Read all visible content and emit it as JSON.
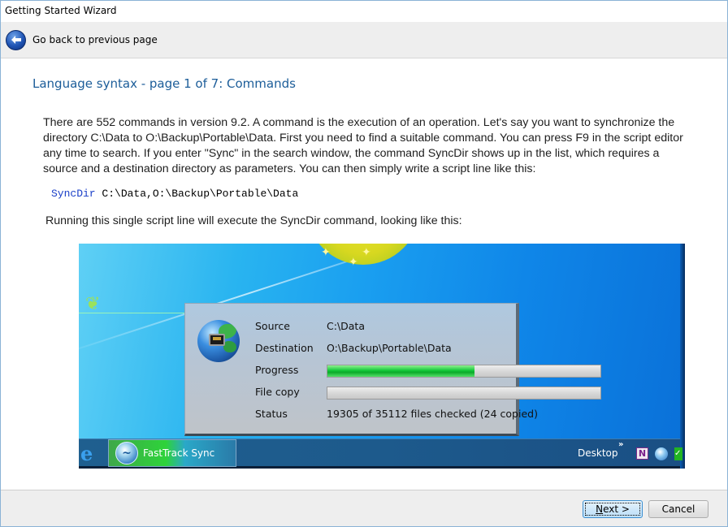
{
  "window": {
    "title": "Getting Started Wizard"
  },
  "nav": {
    "back_label": "Go back to previous page",
    "back_icon": "back-arrow-icon"
  },
  "page": {
    "title": "Language syntax - page 1 of 7: Commands",
    "intro": "There are 552 commands in version 9.2. A command is the execution of an operation. Let's say you want to synchronize the directory C:\\Data to O:\\Backup\\Portable\\Data. First you need to find a suitable command. You can press F9 in the script editor any time to search. If you enter \"Sync\" in the search window, the command SyncDir shows up in the list, which requires a source and a destination directory as parameters. You can then simply write a script line like this:",
    "code": {
      "keyword": "SyncDir",
      "args": " C:\\Data,O:\\Backup\\Portable\\Data"
    },
    "running_text": "Running this single script line will execute the SyncDir command, looking like this:"
  },
  "screenshot": {
    "sync_dialog": {
      "icon": "globe-network-icon",
      "rows": [
        {
          "label": "Source",
          "value": "C:\\Data"
        },
        {
          "label": "Destination",
          "value": "O:\\Backup\\Portable\\Data"
        },
        {
          "label": "Progress",
          "progress": 0.54
        },
        {
          "label": "File copy",
          "progress": 0.0
        },
        {
          "label": "Status",
          "value": "19305 of 35112 files checked (24 copied)"
        }
      ]
    },
    "taskbar": {
      "task_label": "FastTrack Sync",
      "desktop_label": "Desktop",
      "chevron": "»",
      "onenote_letter": "N"
    }
  },
  "footer": {
    "next_mnemonic": "N",
    "next_rest": "ext >",
    "cancel_label": "Cancel"
  },
  "colors": {
    "title_blue": "#1c5d99",
    "code_keyword": "#1a3fc8",
    "progress_green": "#12c83a"
  }
}
